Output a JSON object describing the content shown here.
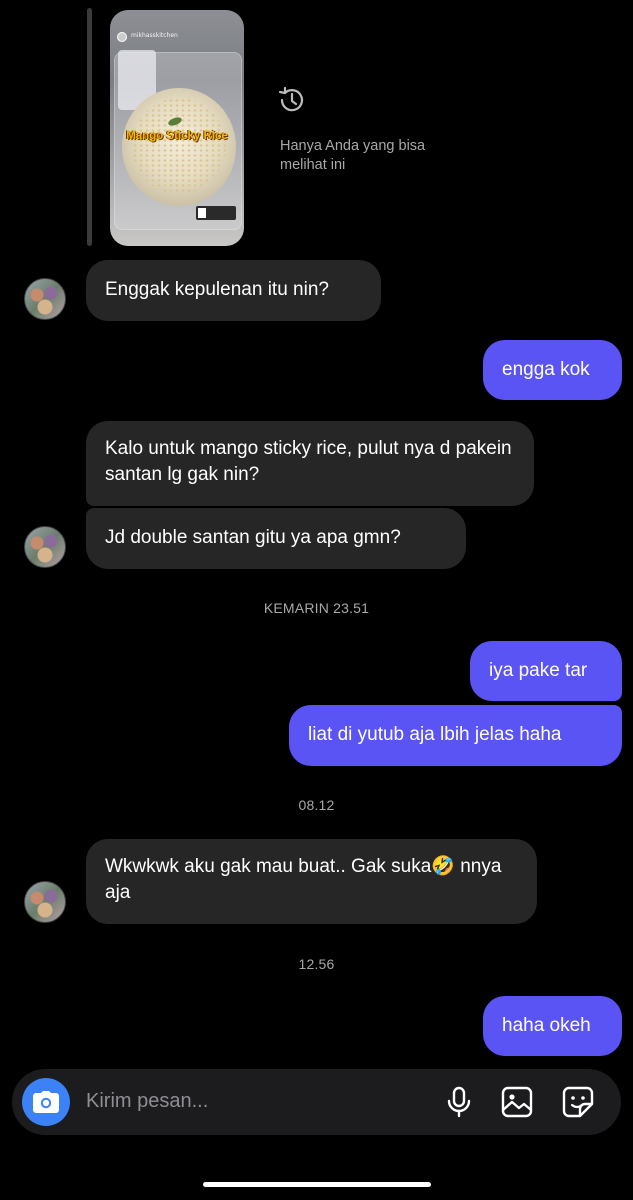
{
  "story_reply": {
    "account_name": "mikhasskitchen",
    "caption": "Mango Sticky Rice",
    "notice": "Hanya Anda yang bisa melihat ini",
    "icon": "history-icon"
  },
  "messages": [
    {
      "dir": "in",
      "text": "Enggak kepulenan itu nin?"
    },
    {
      "dir": "out",
      "text": "engga kok"
    },
    {
      "dir": "in",
      "text": "Kalo untuk mango sticky rice, pulut nya d pakein santan lg gak nin?"
    },
    {
      "dir": "in",
      "text": "Jd double santan gitu ya apa gmn?"
    },
    {
      "dir": "out",
      "text": "iya pake tar"
    },
    {
      "dir": "out",
      "text": "liat di yutub aja lbih jelas haha"
    },
    {
      "dir": "in",
      "text": "Wkwkwk aku gak mau buat.. Gak suka🤣 nnya aja"
    },
    {
      "dir": "out",
      "text": "haha okeh"
    }
  ],
  "timestamps": [
    "KEMARIN 23.51",
    "08.12",
    "12.56"
  ],
  "composer": {
    "placeholder": "Kirim pesan...",
    "icons": [
      "camera-icon",
      "microphone-icon",
      "gallery-icon",
      "sticker-icon"
    ]
  },
  "colors": {
    "background": "#000000",
    "incoming_bubble": "#262626",
    "outgoing_bubble": "#5b54f5",
    "camera_button": "#3b82f6",
    "secondary_text": "#a8a8a8"
  }
}
